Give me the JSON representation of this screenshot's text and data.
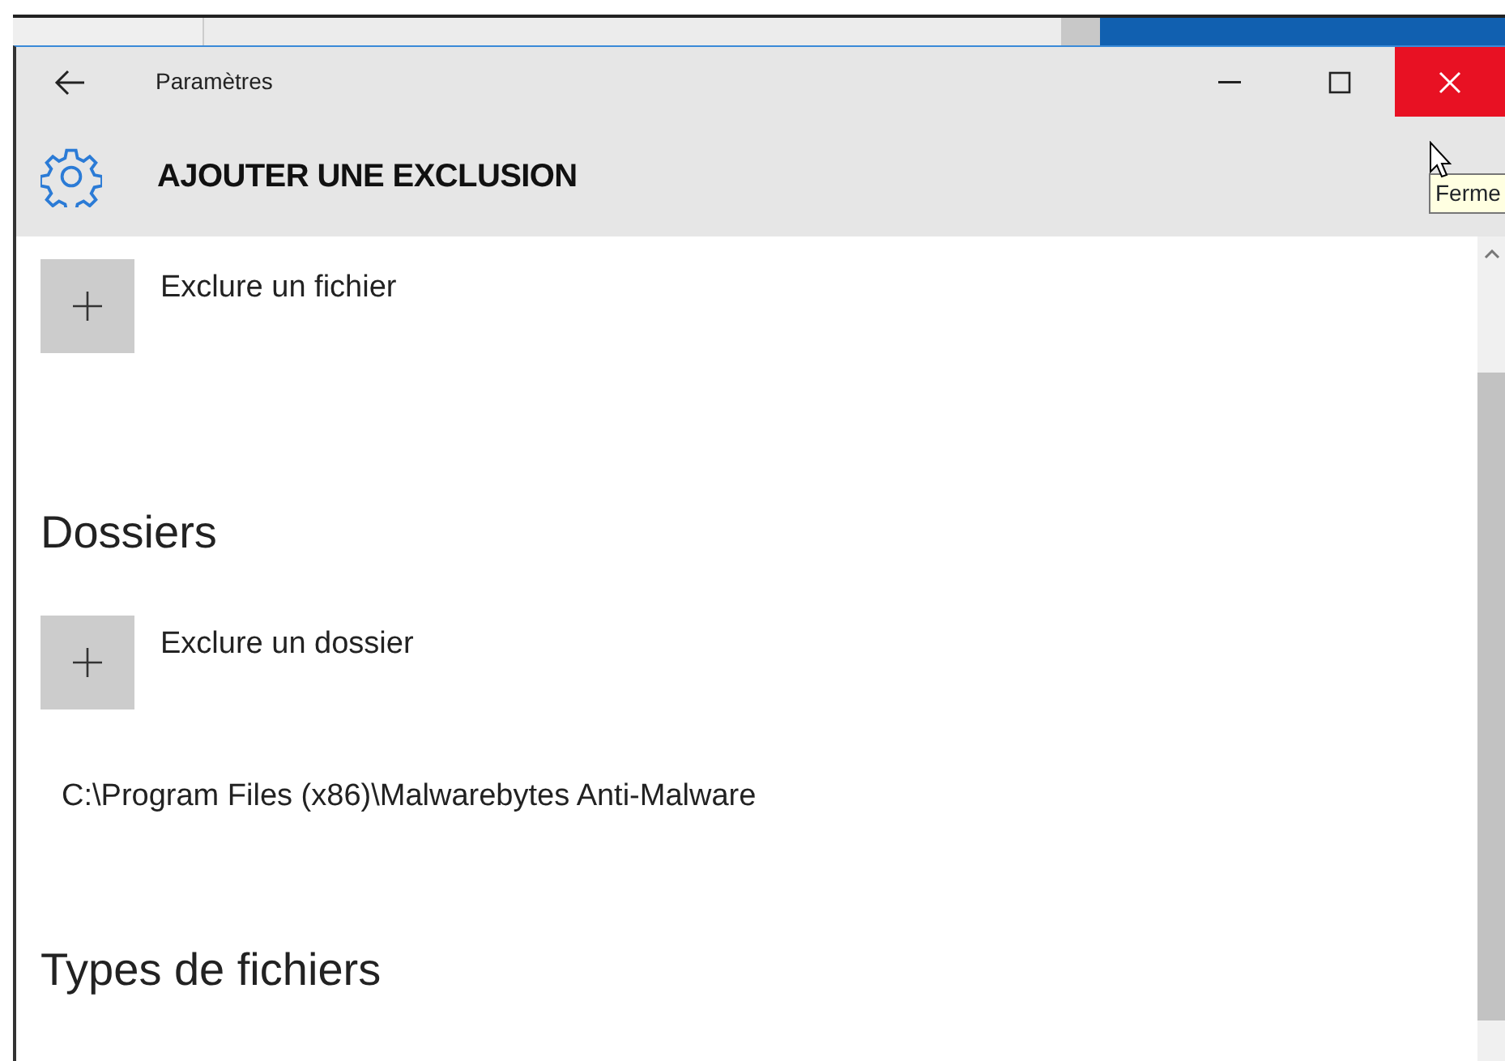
{
  "window": {
    "title": "Paramètres"
  },
  "header": {
    "title": "AJOUTER UNE EXCLUSION"
  },
  "tooltip": {
    "text": "Ferme"
  },
  "content": [
    {
      "kind": "add",
      "label": "Exclure un fichier"
    },
    {
      "kind": "heading",
      "text": "Dossiers"
    },
    {
      "kind": "add",
      "label": "Exclure un dossier"
    },
    {
      "kind": "path",
      "text": "C:\\Program Files (x86)\\Malwarebytes Anti-Malware"
    },
    {
      "kind": "heading",
      "text": "Types de fichiers"
    }
  ]
}
